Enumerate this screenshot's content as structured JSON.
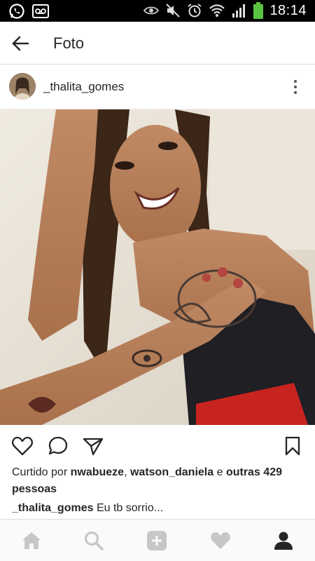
{
  "status_bar": {
    "time": "18:14",
    "icons": [
      "whatsapp-icon",
      "voicemail-icon",
      "eye-icon",
      "mute-icon",
      "alarm-icon",
      "wifi-icon",
      "signal-icon",
      "battery-icon"
    ]
  },
  "app_bar": {
    "title": "Foto"
  },
  "post": {
    "username": "_thalita_gomes",
    "likes": {
      "prefix": "Curtido por",
      "user1": "nwabueze",
      "separator": ",",
      "user2": "watson_daniela",
      "conjunction": "e",
      "others": "outras 429 pessoas"
    },
    "caption": {
      "username": "_thalita_gomes",
      "text": "Eu tb sorrio..."
    }
  },
  "bottom_nav": [
    "home-icon",
    "search-icon",
    "add-icon",
    "activity-heart-icon",
    "profile-icon"
  ],
  "colors": {
    "text": "#262626",
    "inactive_icon": "#c7c7c7",
    "active_icon": "#262626",
    "status_bar": "#000000",
    "battery": "#5ac341"
  }
}
